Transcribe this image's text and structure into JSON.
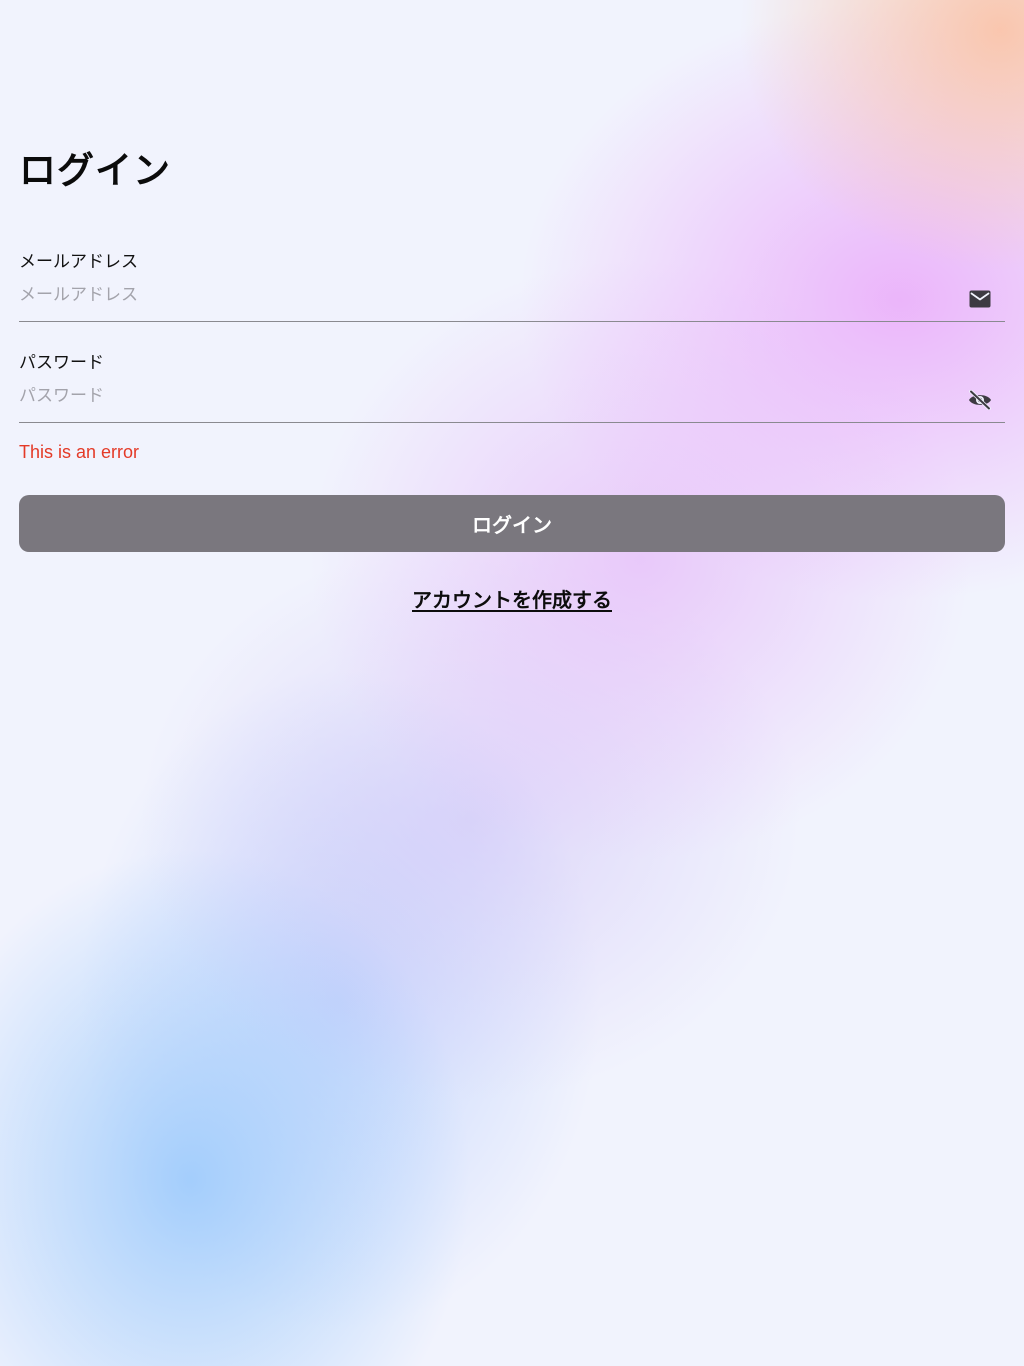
{
  "page": {
    "title": "ログイン"
  },
  "email": {
    "label": "メールアドレス",
    "value": "",
    "placeholder": "メールアドレス",
    "icon": "mail-icon"
  },
  "password": {
    "label": "パスワード",
    "value": "",
    "placeholder": "パスワード",
    "icon": "eye-off-icon"
  },
  "error": {
    "message": "This is an error"
  },
  "actions": {
    "login_label": "ログイン",
    "create_account_label": "アカウントを作成する"
  },
  "colors": {
    "background": "#f1f3fd",
    "error": "#e43a27",
    "button_background": "#7a777e",
    "button_text": "#ffffff",
    "placeholder": "#a3a3ab",
    "icon": "#3d3a42"
  }
}
